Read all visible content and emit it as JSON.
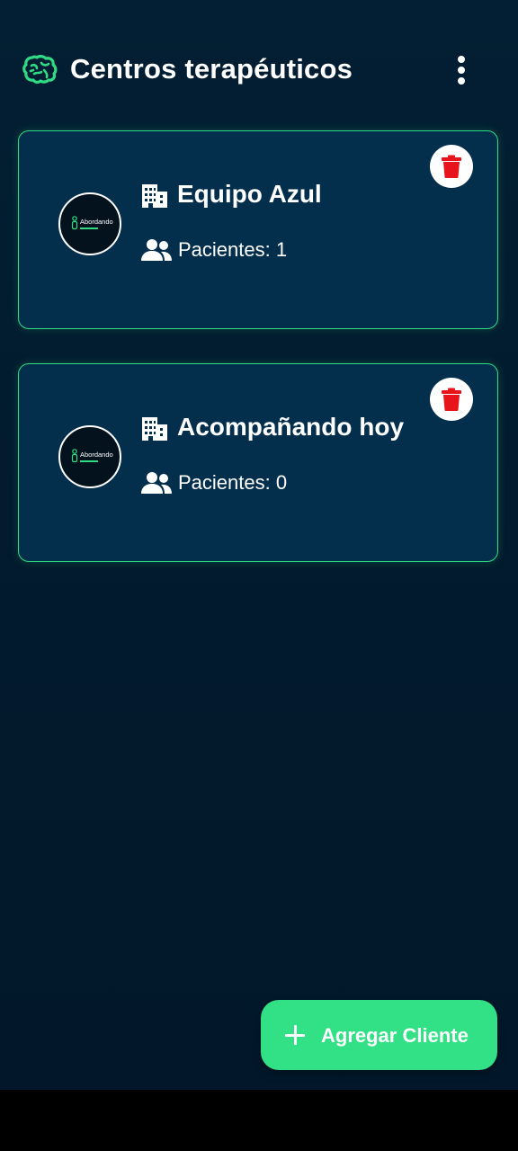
{
  "header": {
    "title": "Centros terapéuticos",
    "logo_icon": "brain-icon",
    "menu_icon": "more-vertical-icon"
  },
  "centers": [
    {
      "name": "Equipo Azul",
      "patients_label": "Pacientes: ",
      "patients_count": "1",
      "avatar_text": "Abordando",
      "icons": [
        "building-icon",
        "users-icon",
        "trash-icon"
      ]
    },
    {
      "name": "Acompañando hoy",
      "patients_label": "Pacientes: ",
      "patients_count": "0",
      "avatar_text": "Abordando",
      "icons": [
        "building-icon",
        "users-icon",
        "trash-icon"
      ]
    }
  ],
  "fab": {
    "label": "Agregar Cliente",
    "icon": "plus-icon"
  },
  "colors": {
    "background": "#021b2e",
    "card_background": "#042f4c",
    "accent_green": "#32e085",
    "delete_red": "#e8141b",
    "text": "#ffffff"
  }
}
